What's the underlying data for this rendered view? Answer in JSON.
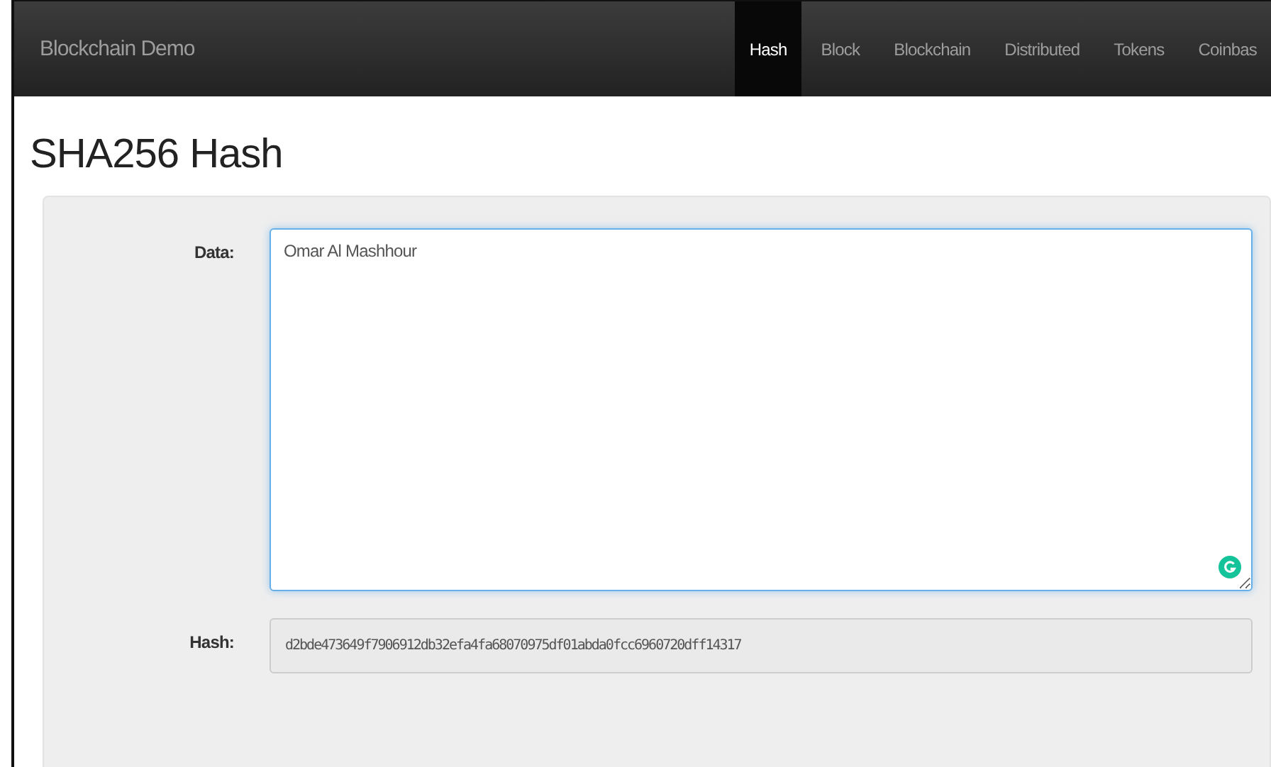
{
  "navbar": {
    "brand": "Blockchain Demo",
    "items": [
      {
        "label": "Hash",
        "selected": true
      },
      {
        "label": "Block",
        "selected": false
      },
      {
        "label": "Blockchain",
        "selected": false
      },
      {
        "label": "Distributed",
        "selected": false
      },
      {
        "label": "Tokens",
        "selected": false
      },
      {
        "label": "Coinbas",
        "selected": false
      }
    ]
  },
  "heading": "SHA256 Hash",
  "form": {
    "data_label": "Data:",
    "data_value": "Omar Al Mashhour",
    "hash_label": "Hash:",
    "hash_value": "d2bde473649f7906912db32efa4fa68070975df01abda0fcc6960720dff14317"
  }
}
